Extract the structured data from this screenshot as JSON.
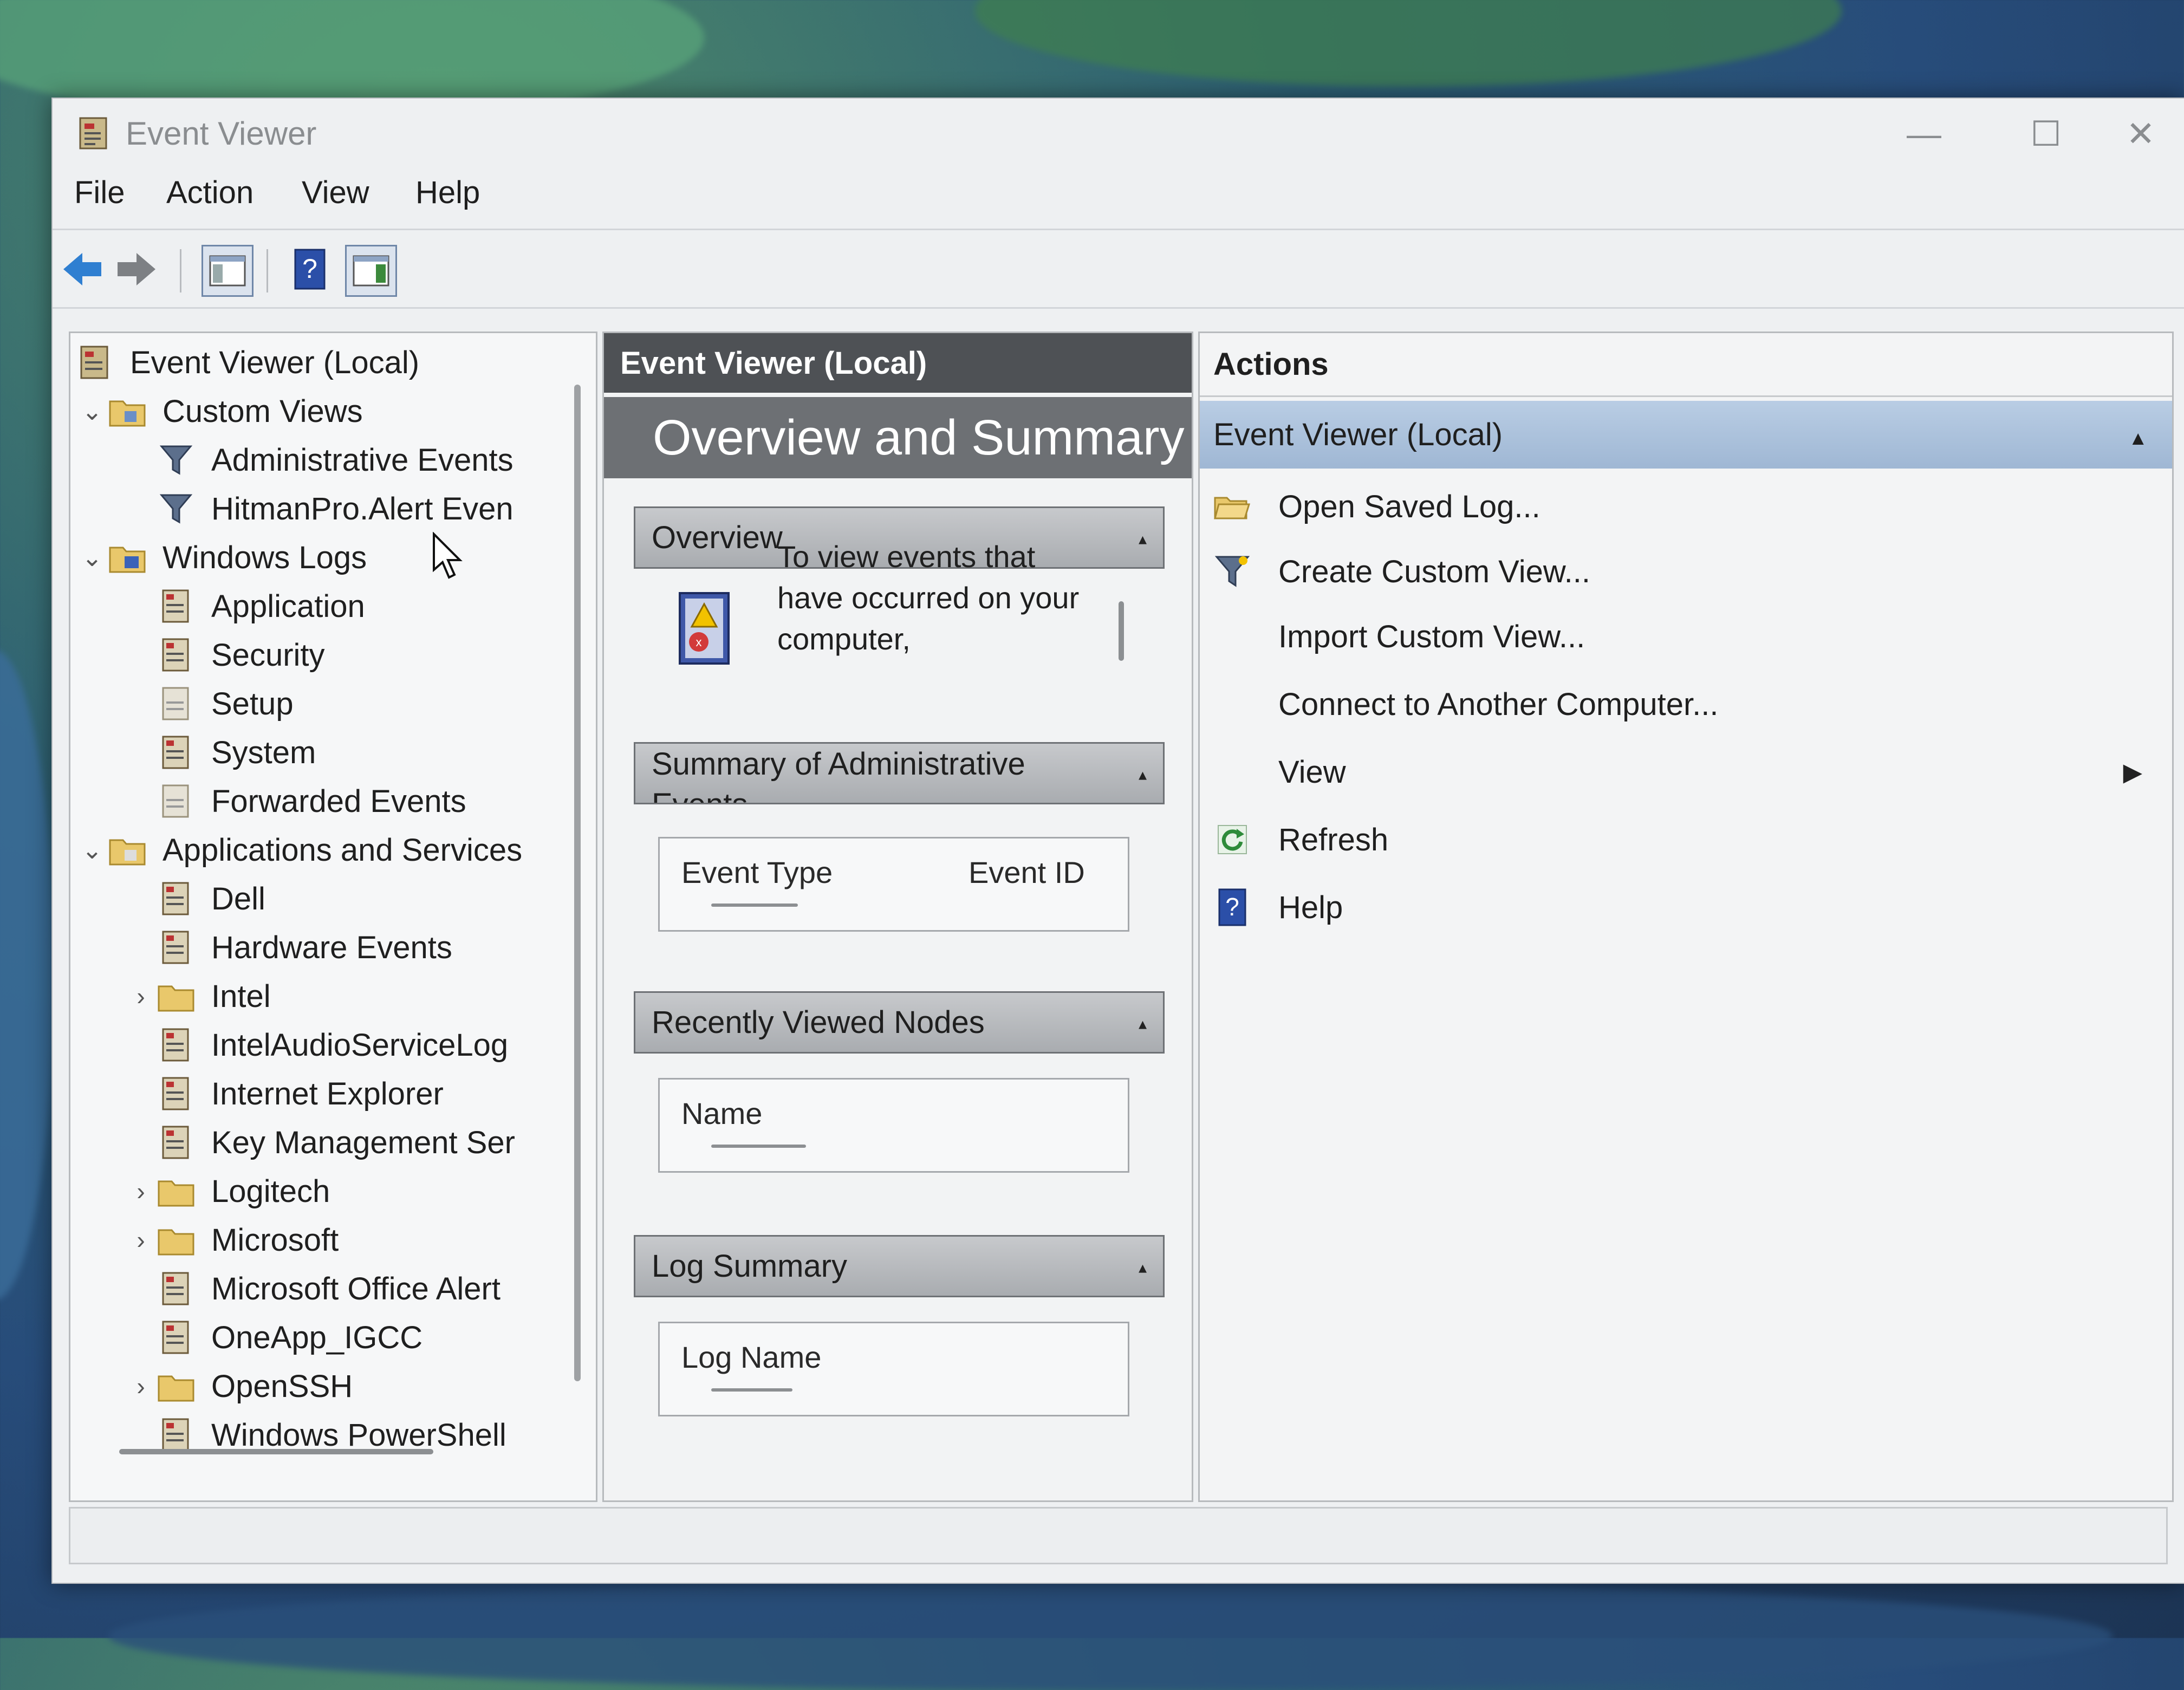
{
  "window": {
    "title": "Event Viewer",
    "controls": {
      "minimize": "—",
      "maximize": "☐",
      "close": "✕"
    }
  },
  "menu": [
    "File",
    "Action",
    "View",
    "Help"
  ],
  "toolbar": {
    "back_icon": "back-arrow-icon",
    "forward_icon": "forward-arrow-icon",
    "show_hide_tree_icon": "console-tree-icon",
    "help_icon": "help-icon",
    "show_hide_action_icon": "action-pane-icon",
    "help_glyph": "?"
  },
  "tree": {
    "root": "Event Viewer (Local)",
    "custom_views": "Custom Views",
    "custom_view_items": [
      "Administrative Events",
      "HitmanPro.Alert Even"
    ],
    "windows_logs": "Windows Logs",
    "windows_log_items": [
      "Application",
      "Security",
      "Setup",
      "System",
      "Forwarded Events"
    ],
    "apps_services": "Applications and Services",
    "apps_items": [
      {
        "label": "Dell",
        "type": "log",
        "expandable": false
      },
      {
        "label": "Hardware Events",
        "type": "log",
        "expandable": false
      },
      {
        "label": "Intel",
        "type": "folder",
        "expandable": true
      },
      {
        "label": "IntelAudioServiceLog",
        "type": "log",
        "expandable": false
      },
      {
        "label": "Internet Explorer",
        "type": "log",
        "expandable": false
      },
      {
        "label": "Key Management Ser",
        "type": "log",
        "expandable": false
      },
      {
        "label": "Logitech",
        "type": "folder",
        "expandable": true
      },
      {
        "label": "Microsoft",
        "type": "folder",
        "expandable": true
      },
      {
        "label": "Microsoft Office Alert",
        "type": "log",
        "expandable": false
      },
      {
        "label": "OneApp_IGCC",
        "type": "log",
        "expandable": false
      },
      {
        "label": "OpenSSH",
        "type": "folder",
        "expandable": true
      },
      {
        "label": "Windows PowerShell",
        "type": "log",
        "expandable": false
      }
    ],
    "chevron_expanded": "⌄",
    "chevron_collapsed": "›"
  },
  "middle": {
    "header": "Event Viewer (Local)",
    "banner": "Overview and Summary",
    "sections": {
      "overview": "Overview",
      "overview_text": "To view events that have occurred on your computer,",
      "summary": "Summary of Administrative Events",
      "summary_columns": [
        "Event Type",
        "Event ID"
      ],
      "recent": "Recently Viewed Nodes",
      "recent_columns": [
        "Name"
      ],
      "log_summary": "Log Summary",
      "log_columns": [
        "Log Name"
      ]
    },
    "caret": "▴"
  },
  "actions": {
    "header": "Actions",
    "group": "Event Viewer (Local)",
    "group_caret": "▲",
    "items": [
      {
        "label": "Open Saved Log...",
        "icon": "open-folder-icon"
      },
      {
        "label": "Create Custom View...",
        "icon": "filter-icon"
      },
      {
        "label": "Import Custom View...",
        "icon": ""
      },
      {
        "label": "Connect to Another Computer...",
        "icon": ""
      },
      {
        "label": "View",
        "icon": "",
        "submenu": true
      },
      {
        "label": "Refresh",
        "icon": "refresh-icon"
      },
      {
        "label": "Help",
        "icon": "help-icon"
      }
    ],
    "submenu_arrow": "▶"
  }
}
